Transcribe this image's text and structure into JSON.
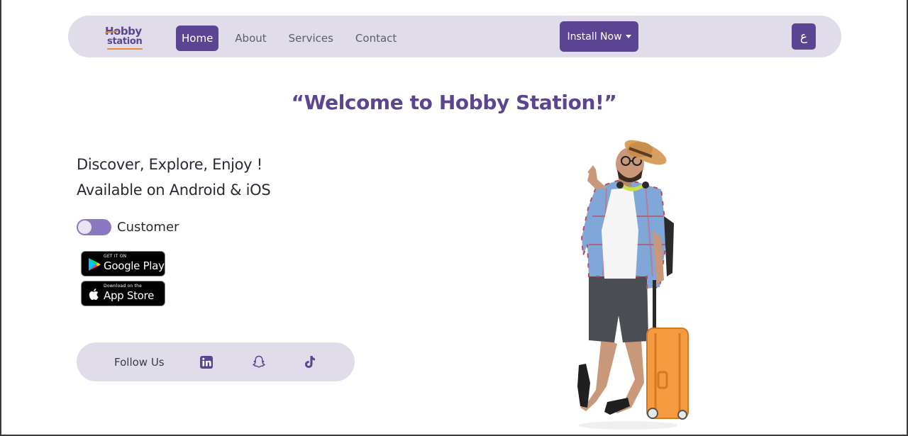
{
  "nav": {
    "logo_line1": "Hobby",
    "logo_line2": "station",
    "links": [
      {
        "label": "Home",
        "active": true
      },
      {
        "label": "About",
        "active": false
      },
      {
        "label": "Services",
        "active": false
      },
      {
        "label": "Contact",
        "active": false
      }
    ],
    "install_label": "Install Now",
    "language_label": "ع"
  },
  "hero": {
    "title": "“Welcome to Hobby Station!”",
    "tagline_1": "Discover, Explore, Enjoy !",
    "tagline_2": "Available on Android & iOS",
    "toggle_label": "Customer"
  },
  "stores": {
    "google_small": "GET IT ON",
    "google_big": "Google Play",
    "apple_small": "Download on the",
    "apple_big": "App Store"
  },
  "social": {
    "follow_label": "Follow Us",
    "icons": [
      "linkedin-icon",
      "snapchat-icon",
      "tiktok-icon"
    ]
  },
  "colors": {
    "brand": "#5b4593",
    "nav_bg": "#e0dcea",
    "accent": "#e08a3a"
  }
}
